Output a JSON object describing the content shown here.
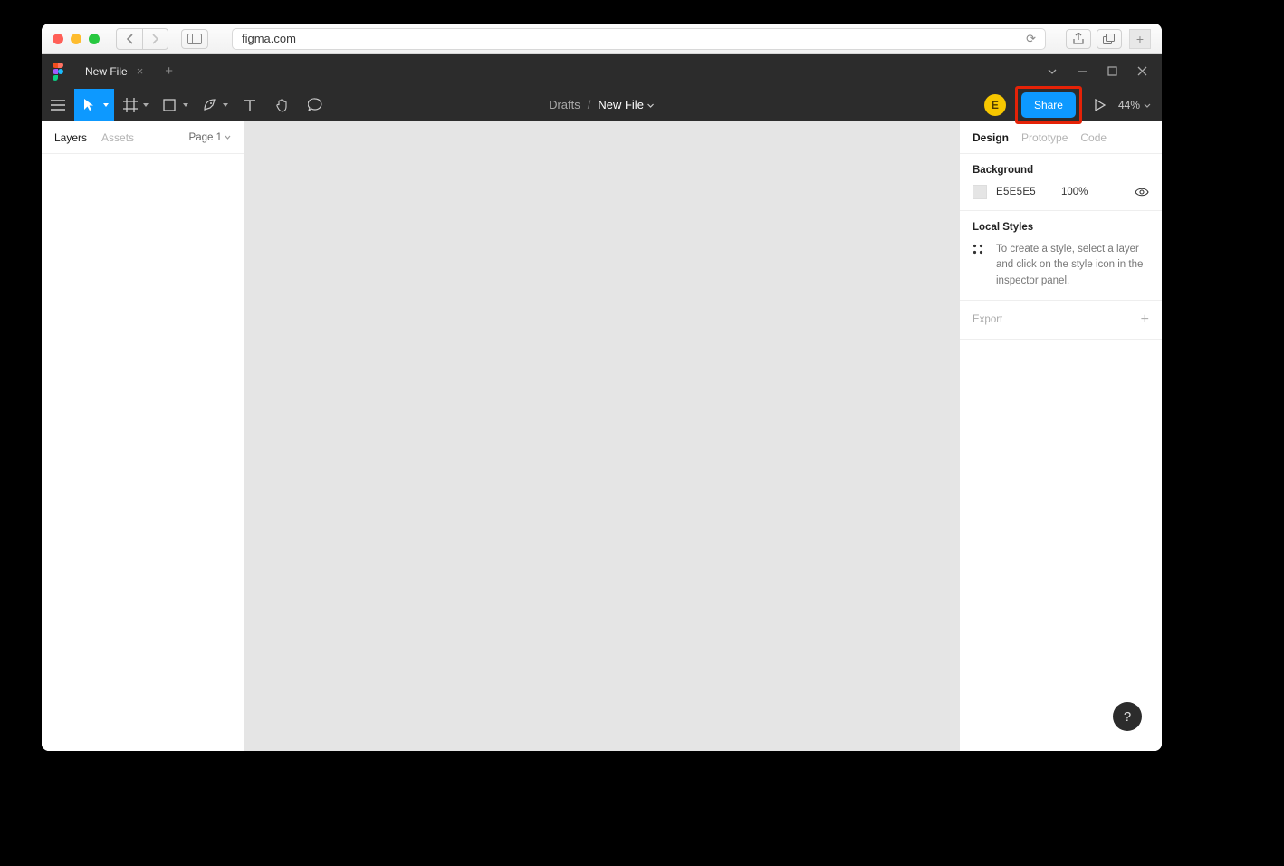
{
  "browser": {
    "url": "figma.com"
  },
  "tabstrip": {
    "file_tab": "New File"
  },
  "breadcrumb": {
    "drafts": "Drafts",
    "separator": "/",
    "file": "New File"
  },
  "toolbar": {
    "avatar_initial": "E",
    "share_label": "Share",
    "zoom": "44%"
  },
  "left_panel": {
    "tabs": {
      "layers": "Layers",
      "assets": "Assets"
    },
    "page_selector": "Page 1"
  },
  "right_panel": {
    "tabs": {
      "design": "Design",
      "prototype": "Prototype",
      "code": "Code"
    },
    "background": {
      "title": "Background",
      "hex": "E5E5E5",
      "opacity": "100%"
    },
    "local_styles": {
      "title": "Local Styles",
      "hint": "To create a style, select a layer and click on the style icon in the inspector panel."
    },
    "export": {
      "title": "Export"
    }
  },
  "help": "?",
  "colors": {
    "accent": "#0d99ff",
    "annotation": "#e52207",
    "canvas": "#e5e5e5",
    "avatar": "#f7c700"
  }
}
